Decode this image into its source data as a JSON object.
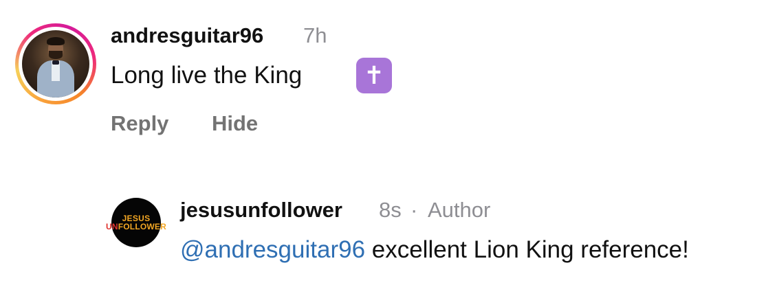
{
  "comments": [
    {
      "username": "andresguitar96",
      "time": "7h",
      "text": "Long live the King",
      "emoji": "✝",
      "actions": {
        "reply": "Reply",
        "hide": "Hide"
      }
    },
    {
      "username": "jesusunfollower",
      "time": "8s",
      "separator": "·",
      "badge": "Author",
      "avatar_text": {
        "line1": "JESUS",
        "line2_prefix": "UN",
        "line2_rest": "FOLLOWER"
      },
      "mention": "@andresguitar96",
      "text": " excellent Lion King reference!"
    }
  ],
  "colors": {
    "mention": "#2f6fb3",
    "meta": "#8e8e93",
    "action": "#737373",
    "emoji_bg": "#a875d8"
  }
}
